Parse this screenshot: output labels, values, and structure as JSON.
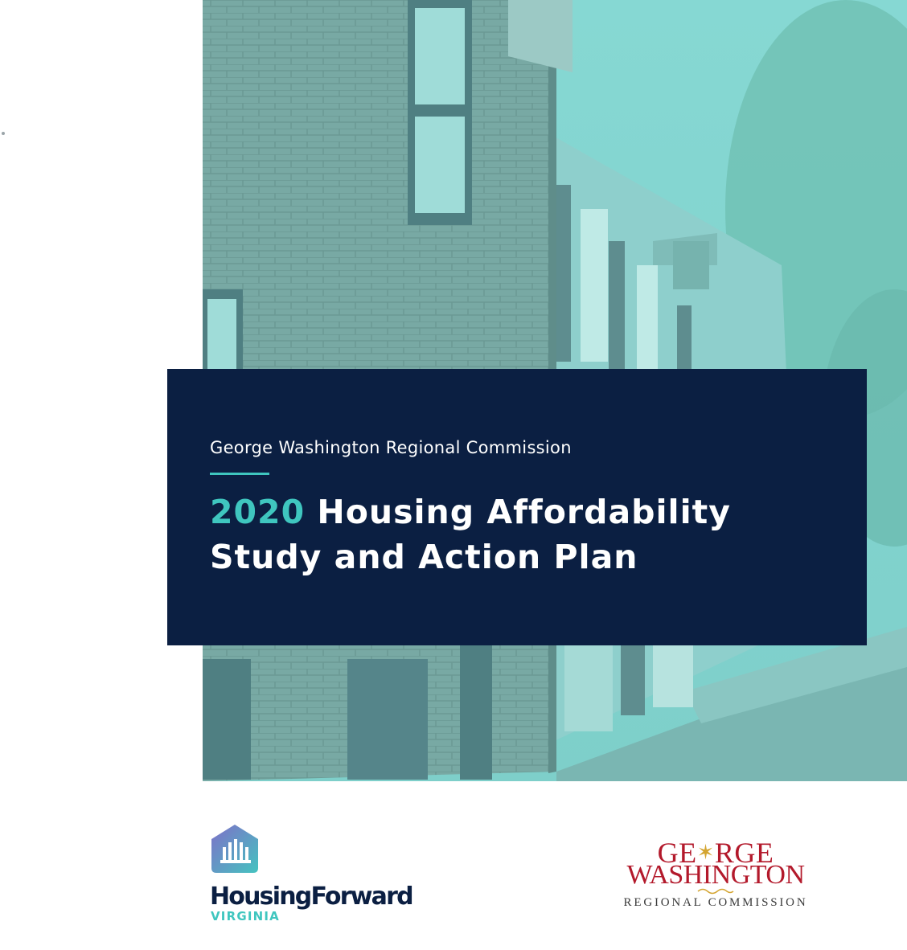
{
  "cover": {
    "organization": "George Washington Regional Commission",
    "title_year": "2020",
    "title_line1_rest": "Housing Affordability",
    "title_line2": "Study and Action Plan"
  },
  "logos": {
    "housing_forward": {
      "name": "HousingForward",
      "sub": "VIRGINIA",
      "icon": "house-columns-icon"
    },
    "gwrc": {
      "line1_a": "GE",
      "line1_b": "RGE",
      "line2": "WASHINGTON",
      "line3": "REGIONAL COMMISSION"
    }
  },
  "colors": {
    "navy": "#0b1f42",
    "teal_accent": "#3fc6bf",
    "photo_tint": "#7fd0cc",
    "gwrc_red": "#b3192b",
    "gwrc_gold": "#d4a531"
  }
}
